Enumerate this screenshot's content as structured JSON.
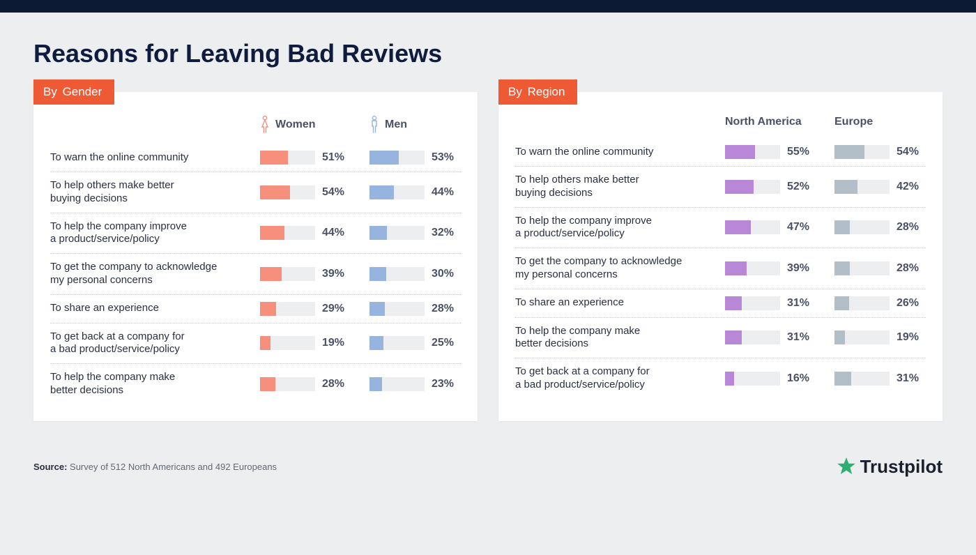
{
  "title": "Reasons for Leaving Bad Reviews",
  "panels": [
    {
      "tag_prefix": "By",
      "tag_value": "Gender",
      "columns": [
        {
          "label": "Women",
          "color": "#f68f7b",
          "icon_color": "#f68f7b"
        },
        {
          "label": "Men",
          "color": "#97b4de",
          "icon_color": "#97b4de"
        }
      ],
      "rows": [
        {
          "label": "To warn the online community",
          "values": [
            51,
            53
          ]
        },
        {
          "label": "To help others make better\nbuying decisions",
          "values": [
            54,
            44
          ]
        },
        {
          "label": "To help the company improve\na product/service/policy",
          "values": [
            44,
            32
          ]
        },
        {
          "label": "To get the company to acknowledge\nmy personal concerns",
          "values": [
            39,
            30
          ]
        },
        {
          "label": "To share an experience",
          "values": [
            29,
            28
          ]
        },
        {
          "label": "To get back at a company for\na bad product/service/policy",
          "values": [
            19,
            25
          ]
        },
        {
          "label": "To help the company make\nbetter decisions",
          "values": [
            28,
            23
          ]
        }
      ]
    },
    {
      "tag_prefix": "By",
      "tag_value": "Region",
      "columns": [
        {
          "label": "North America",
          "color": "#b887d8"
        },
        {
          "label": "Europe",
          "color": "#b3bfc8"
        }
      ],
      "rows": [
        {
          "label": "To warn the online community",
          "values": [
            55,
            54
          ]
        },
        {
          "label": "To help others make better\nbuying decisions",
          "values": [
            52,
            42
          ]
        },
        {
          "label": "To help the company improve\na product/service/policy",
          "values": [
            47,
            28
          ]
        },
        {
          "label": "To get the company to acknowledge\nmy personal concerns",
          "values": [
            39,
            28
          ]
        },
        {
          "label": "To share an experience",
          "values": [
            31,
            26
          ]
        },
        {
          "label": "To help the company make\nbetter decisions",
          "values": [
            31,
            19
          ]
        },
        {
          "label": "To get back at a company for\na bad product/service/policy",
          "values": [
            16,
            31
          ]
        }
      ]
    }
  ],
  "source_label": "Source:",
  "source_text": "Survey of 512 North Americans and 492 Europeans",
  "brand": "Trustpilot",
  "chart_data": [
    {
      "type": "bar",
      "title": "Reasons for Leaving Bad Reviews — By Gender",
      "xlabel": "",
      "ylabel": "Percent",
      "ylim": [
        0,
        100
      ],
      "categories": [
        "To warn the online community",
        "To help others make better buying decisions",
        "To help the company improve a product/service/policy",
        "To get the company to acknowledge my personal concerns",
        "To share an experience",
        "To get back at a company for a bad product/service/policy",
        "To help the company make better decisions"
      ],
      "series": [
        {
          "name": "Women",
          "values": [
            51,
            54,
            44,
            39,
            29,
            19,
            28
          ]
        },
        {
          "name": "Men",
          "values": [
            53,
            44,
            32,
            30,
            28,
            25,
            23
          ]
        }
      ]
    },
    {
      "type": "bar",
      "title": "Reasons for Leaving Bad Reviews — By Region",
      "xlabel": "",
      "ylabel": "Percent",
      "ylim": [
        0,
        100
      ],
      "categories": [
        "To warn the online community",
        "To help others make better buying decisions",
        "To help the company improve a product/service/policy",
        "To get the company to acknowledge my personal concerns",
        "To share an experience",
        "To help the company make better decisions",
        "To get back at a company for a bad product/service/policy"
      ],
      "series": [
        {
          "name": "North America",
          "values": [
            55,
            52,
            47,
            39,
            31,
            31,
            16
          ]
        },
        {
          "name": "Europe",
          "values": [
            54,
            42,
            28,
            28,
            26,
            19,
            31
          ]
        }
      ]
    }
  ]
}
